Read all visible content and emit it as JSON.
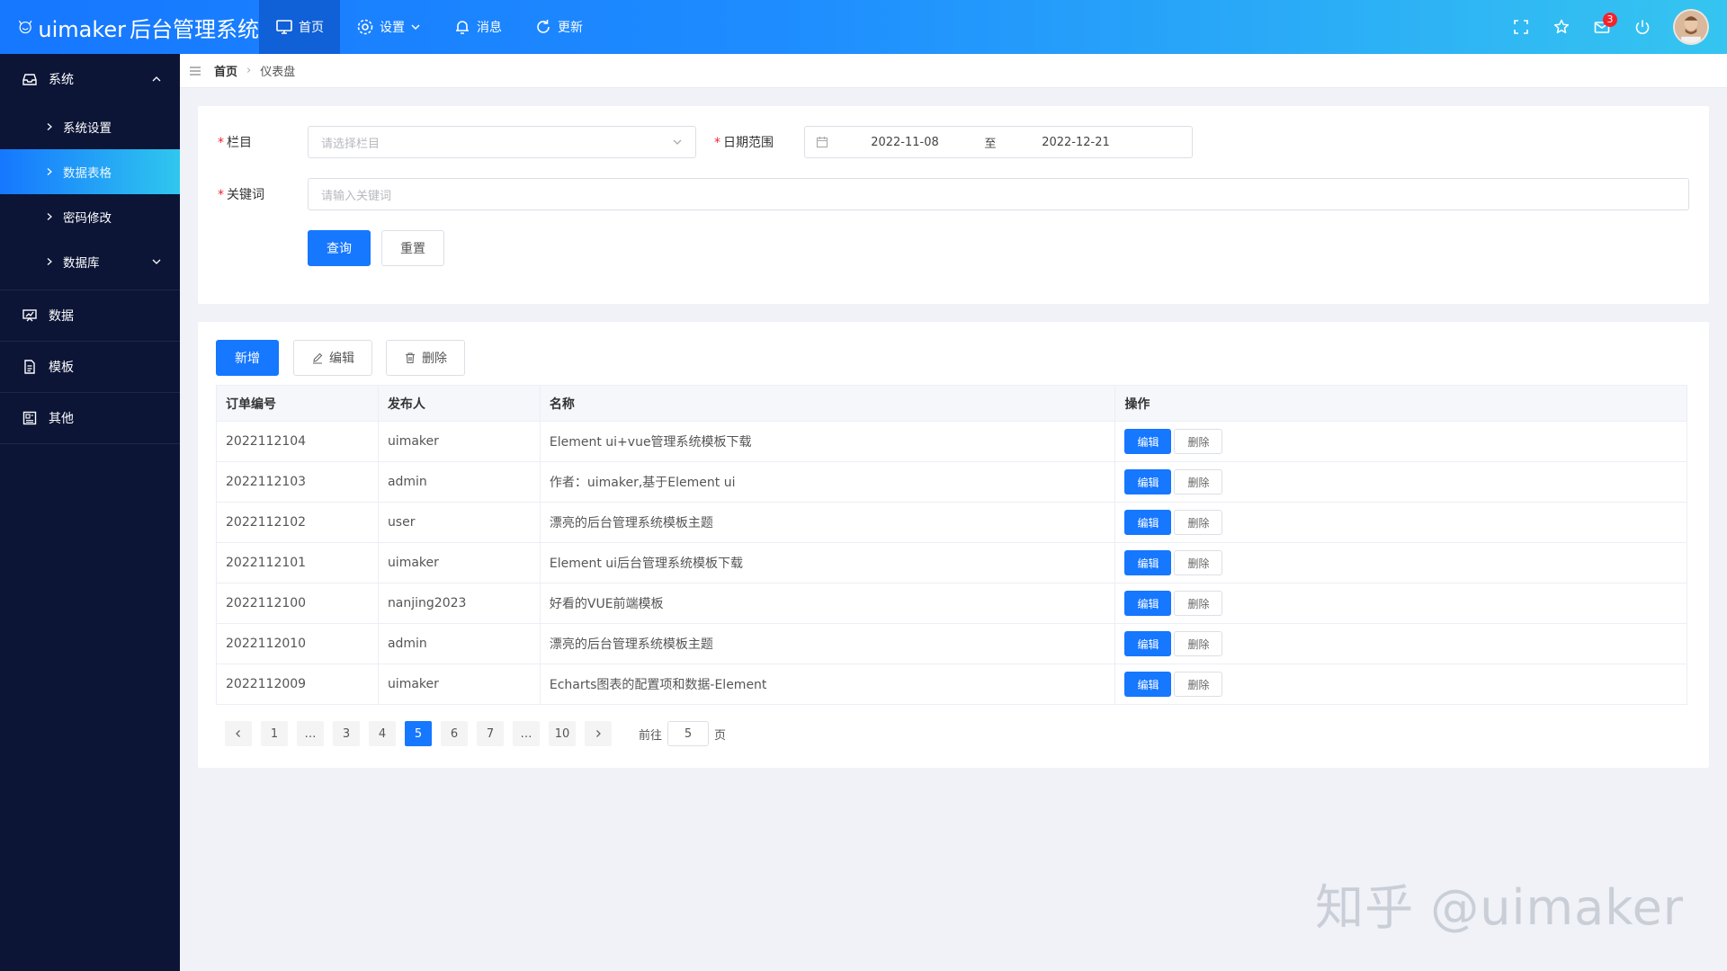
{
  "app": {
    "brand_prefix": "uimaker",
    "brand_suffix": "后台管理系统"
  },
  "topnav": [
    {
      "label": "首页",
      "icon": "monitor-icon",
      "active": true
    },
    {
      "label": "设置",
      "icon": "gear-icon",
      "has_caret": true
    },
    {
      "label": "消息",
      "icon": "bell-icon"
    },
    {
      "label": "更新",
      "icon": "refresh-icon"
    }
  ],
  "topright": {
    "mail_badge": "3"
  },
  "sidebar": {
    "system": {
      "label": "系统"
    },
    "sub_items": [
      {
        "label": "系统设置"
      },
      {
        "label": "数据表格",
        "active": true
      },
      {
        "label": "密码修改"
      },
      {
        "label": "数据库"
      }
    ],
    "data": {
      "label": "数据"
    },
    "template": {
      "label": "模板"
    },
    "other": {
      "label": "其他"
    }
  },
  "breadcrumb": {
    "home": "首页",
    "current": "仪表盘"
  },
  "search_form": {
    "column_label": "栏目",
    "column_placeholder": "请选择栏目",
    "date_label": "日期范围",
    "date_start": "2022-11-08",
    "date_to": "至",
    "date_end": "2022-12-21",
    "keyword_label": "关键词",
    "keyword_placeholder": "请输入关键词",
    "query_button": "查询",
    "reset_button": "重置"
  },
  "toolbar": {
    "add": "新增",
    "edit": "编辑",
    "delete": "删除"
  },
  "table": {
    "headers": [
      "订单编号",
      "发布人",
      "名称",
      "操作"
    ],
    "row_edit": "编辑",
    "row_delete": "删除",
    "rows": [
      {
        "id": "2022112104",
        "author": "uimaker",
        "name": "Element ui+vue管理系统模板下载"
      },
      {
        "id": "2022112103",
        "author": "admin",
        "name": "作者：uimaker,基于Element ui"
      },
      {
        "id": "2022112102",
        "author": "user",
        "name": "漂亮的后台管理系统模板主题"
      },
      {
        "id": "2022112101",
        "author": "uimaker",
        "name": "Element ui后台管理系统模板下载"
      },
      {
        "id": "2022112100",
        "author": "nanjing2023",
        "name": "好看的VUE前端模板"
      },
      {
        "id": "2022112010",
        "author": "admin",
        "name": "漂亮的后台管理系统模板主题"
      },
      {
        "id": "2022112009",
        "author": "uimaker",
        "name": "Echarts图表的配置项和数据-Element"
      }
    ]
  },
  "pagination": {
    "pages": [
      "1",
      "…",
      "3",
      "4",
      "5",
      "6",
      "7",
      "…",
      "10"
    ],
    "current": "5",
    "goto_prefix": "前往",
    "goto_value": "5",
    "goto_suffix": "页"
  },
  "watermark": "知乎 @uimaker",
  "colors": {
    "primary": "#1677ff",
    "sidebar_bg": "#0c1536",
    "topbar_gradient_end": "#35c5f0"
  }
}
